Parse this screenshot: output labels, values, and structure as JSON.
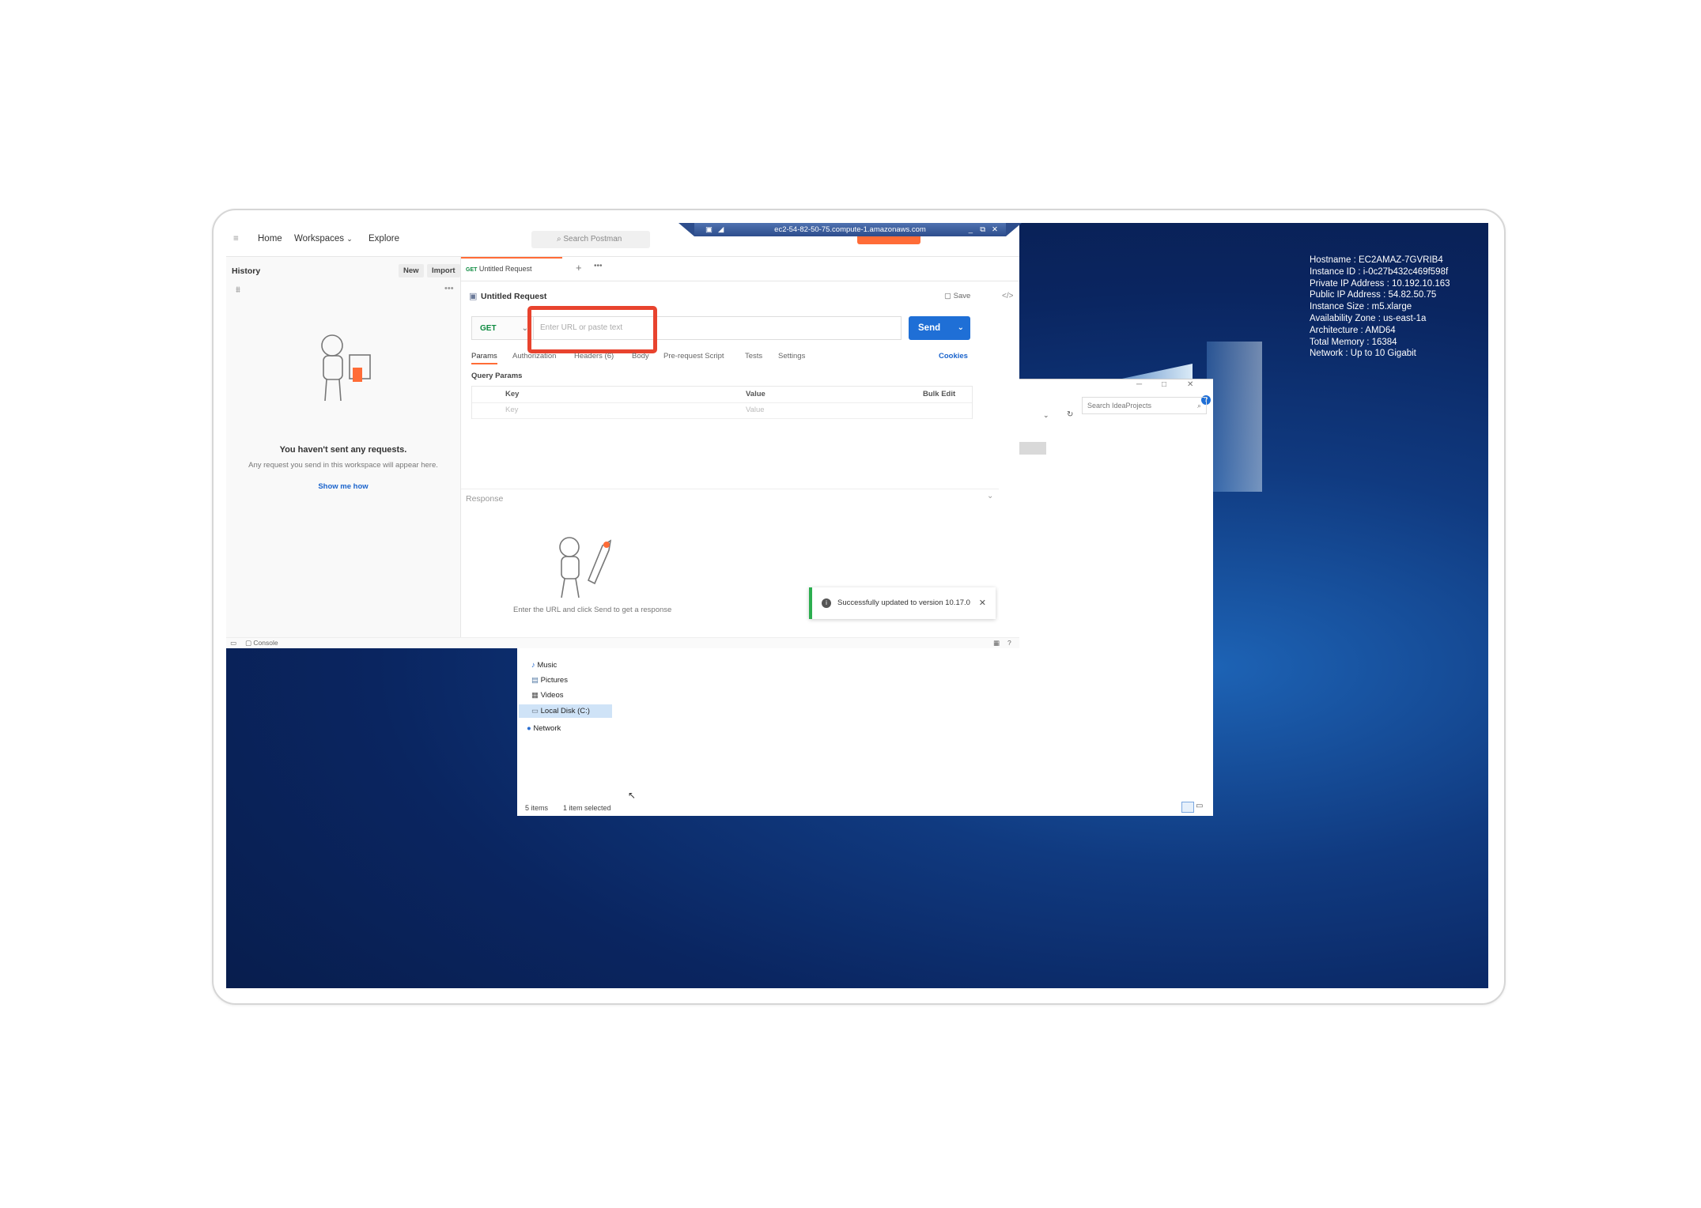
{
  "rdp": {
    "title": "ec2-54-82-50-75.compute-1.amazonaws.com"
  },
  "sysinfo": [
    "Hostname : EC2AMAZ-7GVRIB4",
    "Instance ID : i-0c27b432c469f598f",
    "Private IP Address : 10.192.10.163",
    "Public IP Address : 54.82.50.75",
    "Instance Size : m5.xlarge",
    "Availability Zone : us-east-1a",
    "Architecture : AMD64",
    "Total Memory : 16384",
    "Network : Up to 10 Gigabit"
  ],
  "postman": {
    "nav": {
      "home": "Home",
      "workspaces": "Workspaces",
      "explore": "Explore"
    },
    "search_placeholder": "Search Postman",
    "sidebar": {
      "title": "History",
      "new_label": "New",
      "import_label": "Import",
      "empty_title": "You haven't sent any requests.",
      "empty_subtitle": "Any request you send in this workspace will appear here.",
      "empty_link": "Show me how"
    },
    "tab": {
      "method": "GET",
      "name": "Untitled Request"
    },
    "request": {
      "title": "Untitled Request",
      "save_label": "Save",
      "method": "GET",
      "url_placeholder": "Enter URL or paste text",
      "send_label": "Send"
    },
    "subtabs": [
      "Params",
      "Authorization",
      "Headers (6)",
      "Body",
      "Pre-request Script",
      "Tests",
      "Settings"
    ],
    "cookies_label": "Cookies",
    "query_params": {
      "title": "Query Params",
      "headers": {
        "key": "Key",
        "value": "Value",
        "bulk_edit": "Bulk Edit"
      },
      "placeholder_row": {
        "key": "Key",
        "value": "Value"
      }
    },
    "response": {
      "title": "Response",
      "hint": "Enter the URL and click Send to get a response"
    },
    "toast": {
      "message": "Successfully updated to version 10.17.0"
    },
    "statusbar": {
      "console": "Console"
    }
  },
  "explorer": {
    "search_placeholder": "Search IdeaProjects",
    "tree": [
      "Music",
      "Pictures",
      "Videos",
      "Local Disk (C:)",
      "Network"
    ],
    "status": {
      "items": "5 items",
      "selected": "1 item selected"
    }
  },
  "colors": {
    "accent_orange": "#ff6c37",
    "send_blue": "#1f6fd6",
    "highlight_red": "#e8432e",
    "success_green": "#2cae4f",
    "desktop_blue": "#0a2560"
  }
}
